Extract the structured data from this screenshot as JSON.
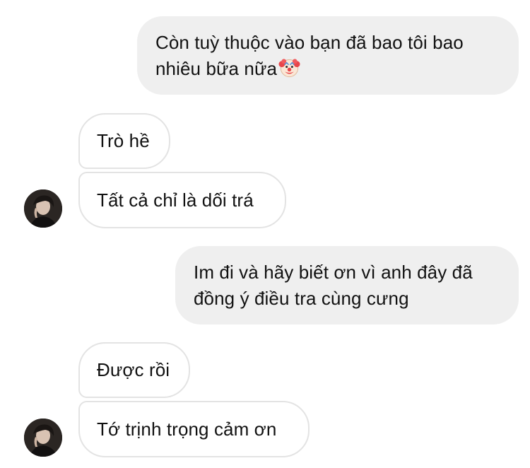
{
  "messages": [
    {
      "id": "m1",
      "direction": "outgoing",
      "text": "Còn tuỳ thuộc vào bạn đã bao tôi bao nhiêu bữa nữa",
      "emoji": "clown-face"
    },
    {
      "id": "m2",
      "direction": "incoming",
      "text": "Trò hề"
    },
    {
      "id": "m3",
      "direction": "incoming",
      "text": "Tất cả chỉ là dối trá"
    },
    {
      "id": "m4",
      "direction": "outgoing",
      "text": "Im đi và hãy biết ơn vì anh đây đã đồng ý điều tra cùng cưng"
    },
    {
      "id": "m5",
      "direction": "incoming",
      "text": "Được rồi"
    },
    {
      "id": "m6",
      "direction": "incoming",
      "text": "Tớ trịnh trọng cảm ơn"
    }
  ],
  "colors": {
    "outgoing_bubble": "#efefef",
    "incoming_border": "#e3e3e3",
    "text": "#111111",
    "background": "#ffffff"
  },
  "icons": {
    "emoji": "clown-face-icon",
    "avatar": "contact-avatar"
  }
}
